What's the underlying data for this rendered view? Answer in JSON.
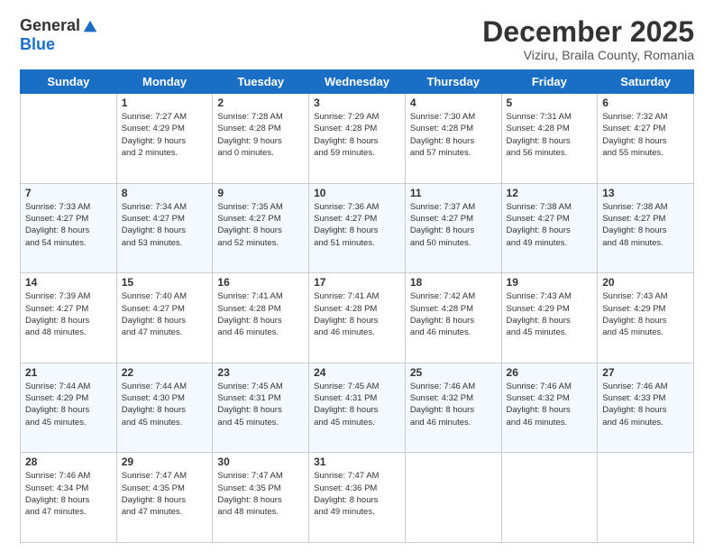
{
  "header": {
    "logo_general": "General",
    "logo_blue": "Blue",
    "month_title": "December 2025",
    "location": "Viziru, Braila County, Romania"
  },
  "days_of_week": [
    "Sunday",
    "Monday",
    "Tuesday",
    "Wednesday",
    "Thursday",
    "Friday",
    "Saturday"
  ],
  "weeks": [
    [
      {
        "day": "",
        "info": ""
      },
      {
        "day": "1",
        "info": "Sunrise: 7:27 AM\nSunset: 4:29 PM\nDaylight: 9 hours\nand 2 minutes."
      },
      {
        "day": "2",
        "info": "Sunrise: 7:28 AM\nSunset: 4:28 PM\nDaylight: 9 hours\nand 0 minutes."
      },
      {
        "day": "3",
        "info": "Sunrise: 7:29 AM\nSunset: 4:28 PM\nDaylight: 8 hours\nand 59 minutes."
      },
      {
        "day": "4",
        "info": "Sunrise: 7:30 AM\nSunset: 4:28 PM\nDaylight: 8 hours\nand 57 minutes."
      },
      {
        "day": "5",
        "info": "Sunrise: 7:31 AM\nSunset: 4:28 PM\nDaylight: 8 hours\nand 56 minutes."
      },
      {
        "day": "6",
        "info": "Sunrise: 7:32 AM\nSunset: 4:27 PM\nDaylight: 8 hours\nand 55 minutes."
      }
    ],
    [
      {
        "day": "7",
        "info": "Sunrise: 7:33 AM\nSunset: 4:27 PM\nDaylight: 8 hours\nand 54 minutes."
      },
      {
        "day": "8",
        "info": "Sunrise: 7:34 AM\nSunset: 4:27 PM\nDaylight: 8 hours\nand 53 minutes."
      },
      {
        "day": "9",
        "info": "Sunrise: 7:35 AM\nSunset: 4:27 PM\nDaylight: 8 hours\nand 52 minutes."
      },
      {
        "day": "10",
        "info": "Sunrise: 7:36 AM\nSunset: 4:27 PM\nDaylight: 8 hours\nand 51 minutes."
      },
      {
        "day": "11",
        "info": "Sunrise: 7:37 AM\nSunset: 4:27 PM\nDaylight: 8 hours\nand 50 minutes."
      },
      {
        "day": "12",
        "info": "Sunrise: 7:38 AM\nSunset: 4:27 PM\nDaylight: 8 hours\nand 49 minutes."
      },
      {
        "day": "13",
        "info": "Sunrise: 7:38 AM\nSunset: 4:27 PM\nDaylight: 8 hours\nand 48 minutes."
      }
    ],
    [
      {
        "day": "14",
        "info": "Sunrise: 7:39 AM\nSunset: 4:27 PM\nDaylight: 8 hours\nand 48 minutes."
      },
      {
        "day": "15",
        "info": "Sunrise: 7:40 AM\nSunset: 4:27 PM\nDaylight: 8 hours\nand 47 minutes."
      },
      {
        "day": "16",
        "info": "Sunrise: 7:41 AM\nSunset: 4:28 PM\nDaylight: 8 hours\nand 46 minutes."
      },
      {
        "day": "17",
        "info": "Sunrise: 7:41 AM\nSunset: 4:28 PM\nDaylight: 8 hours\nand 46 minutes."
      },
      {
        "day": "18",
        "info": "Sunrise: 7:42 AM\nSunset: 4:28 PM\nDaylight: 8 hours\nand 46 minutes."
      },
      {
        "day": "19",
        "info": "Sunrise: 7:43 AM\nSunset: 4:29 PM\nDaylight: 8 hours\nand 45 minutes."
      },
      {
        "day": "20",
        "info": "Sunrise: 7:43 AM\nSunset: 4:29 PM\nDaylight: 8 hours\nand 45 minutes."
      }
    ],
    [
      {
        "day": "21",
        "info": "Sunrise: 7:44 AM\nSunset: 4:29 PM\nDaylight: 8 hours\nand 45 minutes."
      },
      {
        "day": "22",
        "info": "Sunrise: 7:44 AM\nSunset: 4:30 PM\nDaylight: 8 hours\nand 45 minutes."
      },
      {
        "day": "23",
        "info": "Sunrise: 7:45 AM\nSunset: 4:31 PM\nDaylight: 8 hours\nand 45 minutes."
      },
      {
        "day": "24",
        "info": "Sunrise: 7:45 AM\nSunset: 4:31 PM\nDaylight: 8 hours\nand 45 minutes."
      },
      {
        "day": "25",
        "info": "Sunrise: 7:46 AM\nSunset: 4:32 PM\nDaylight: 8 hours\nand 46 minutes."
      },
      {
        "day": "26",
        "info": "Sunrise: 7:46 AM\nSunset: 4:32 PM\nDaylight: 8 hours\nand 46 minutes."
      },
      {
        "day": "27",
        "info": "Sunrise: 7:46 AM\nSunset: 4:33 PM\nDaylight: 8 hours\nand 46 minutes."
      }
    ],
    [
      {
        "day": "28",
        "info": "Sunrise: 7:46 AM\nSunset: 4:34 PM\nDaylight: 8 hours\nand 47 minutes."
      },
      {
        "day": "29",
        "info": "Sunrise: 7:47 AM\nSunset: 4:35 PM\nDaylight: 8 hours\nand 47 minutes."
      },
      {
        "day": "30",
        "info": "Sunrise: 7:47 AM\nSunset: 4:35 PM\nDaylight: 8 hours\nand 48 minutes."
      },
      {
        "day": "31",
        "info": "Sunrise: 7:47 AM\nSunset: 4:36 PM\nDaylight: 8 hours\nand 49 minutes."
      },
      {
        "day": "",
        "info": ""
      },
      {
        "day": "",
        "info": ""
      },
      {
        "day": "",
        "info": ""
      }
    ]
  ]
}
